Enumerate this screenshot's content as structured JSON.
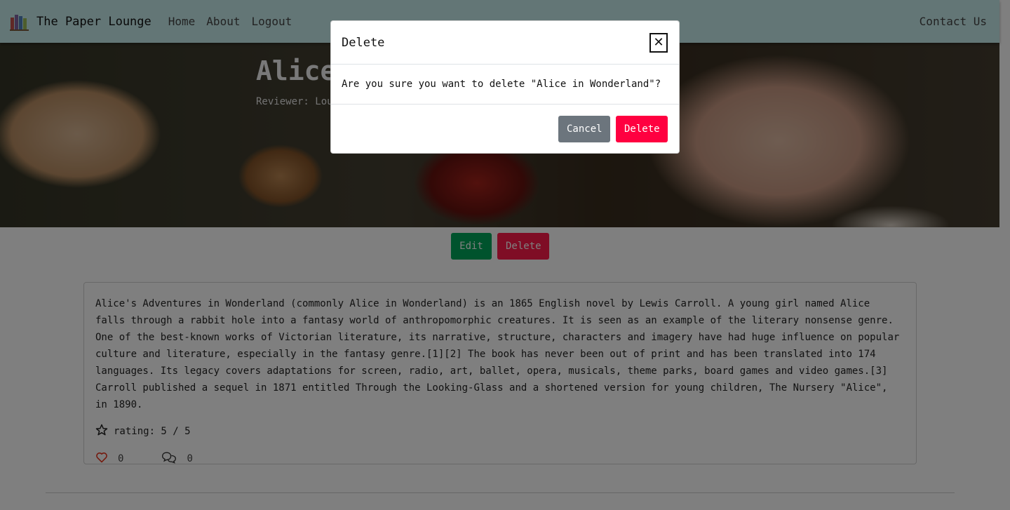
{
  "navbar": {
    "brand": "The Paper Lounge",
    "links": [
      "Home",
      "About",
      "Logout"
    ],
    "right_link": "Contact Us"
  },
  "hero": {
    "title": "Alice in Wonderland",
    "subtitle": "Reviewer: Lounge"
  },
  "actions": {
    "edit_label": "Edit",
    "delete_label": "Delete"
  },
  "review": {
    "text": "Alice's Adventures in Wonderland (commonly Alice in Wonderland) is an 1865 English novel by Lewis Carroll. A young girl named Alice falls through a rabbit hole into a fantasy world of anthropomorphic creatures. It is seen as an example of the literary nonsense genre. One of the best-known works of Victorian literature, its narrative, structure, characters and imagery have had huge influence on popular culture and literature, especially in the fantasy genre.[1][2] The book has never been out of print and has been translated into 174 languages. Its legacy covers adaptations for screen, radio, art, ballet, opera, musicals, theme parks, board games and video games.[3] Carroll published a sequel in 1871 entitled Through the Looking-Glass and a shortened version for young children, The Nursery \"Alice\", in 1890.",
    "rating_text": "rating: 5 / 5",
    "likes": "0",
    "comments": "0"
  },
  "modal": {
    "title": "Delete",
    "close_symbol": "✕",
    "message": "Are you sure you want to delete \"Alice in Wonderland\"?",
    "cancel_label": "Cancel",
    "confirm_label": "Delete"
  },
  "colors": {
    "navbar_bg": "#c6ecec",
    "edit_button": "#00a65a",
    "delete_button": "#ff1a4b",
    "cancel_button": "#6c757d",
    "confirm_button": "#ff0040",
    "heart": "#e8341c"
  },
  "icons": {
    "brand": "books-icon",
    "rating": "star-icon",
    "likes": "heart-icon",
    "comments": "chat-bubbles-icon",
    "close": "close-icon"
  }
}
